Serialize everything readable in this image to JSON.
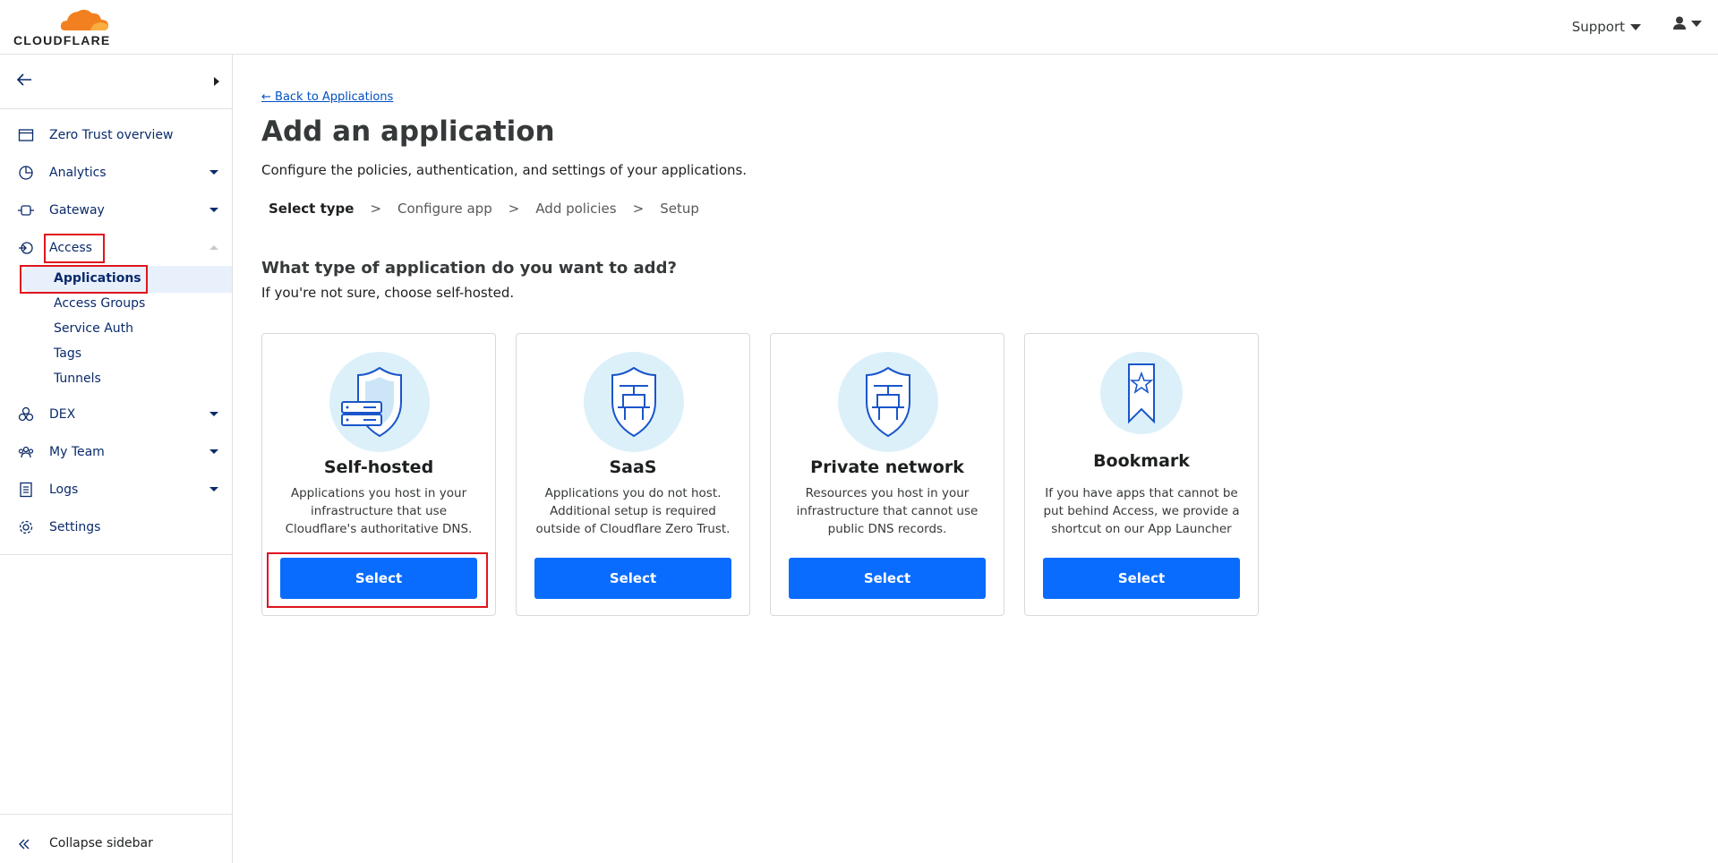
{
  "header": {
    "logo_text": "CLOUDFLARE",
    "support_label": "Support"
  },
  "sidebar": {
    "items": [
      {
        "label": "Zero Trust overview",
        "icon": "browser-window-icon"
      },
      {
        "label": "Analytics",
        "icon": "pie-chart-icon"
      },
      {
        "label": "Gateway",
        "icon": "gateway-icon"
      },
      {
        "label": "Access",
        "icon": "access-icon"
      },
      {
        "label": "DEX",
        "icon": "dex-icon"
      },
      {
        "label": "My Team",
        "icon": "team-icon"
      },
      {
        "label": "Logs",
        "icon": "logs-icon"
      },
      {
        "label": "Settings",
        "icon": "gear-icon"
      }
    ],
    "access_sub": [
      "Applications",
      "Access Groups",
      "Service Auth",
      "Tags",
      "Tunnels"
    ],
    "collapse_label": "Collapse sidebar"
  },
  "main": {
    "back_link": "← Back to Applications",
    "title": "Add an application",
    "description": "Configure the policies, authentication, and settings of your applications.",
    "steps": [
      "Select type",
      "Configure app",
      "Add policies",
      "Setup"
    ],
    "step_separator": ">",
    "question": "What type of application do you want to add?",
    "question_sub": "If you're not sure, choose self-hosted.",
    "cards": [
      {
        "title": "Self-hosted",
        "desc": "Applications you host in your infrastructure that use Cloudflare's authoritative DNS.",
        "button": "Select"
      },
      {
        "title": "SaaS",
        "desc": "Applications you do not host. Additional setup is required outside of Cloudflare Zero Trust.",
        "button": "Select"
      },
      {
        "title": "Private network",
        "desc": "Resources you host in your infrastructure that cannot use public DNS records.",
        "button": "Select"
      },
      {
        "title": "Bookmark",
        "desc": "If you have apps that cannot be put behind Access, we provide a shortcut on our App Launcher",
        "button": "Select"
      }
    ]
  },
  "colors": {
    "accent": "#0a6cff",
    "nav_text": "#0a2a6b",
    "highlight": "#e0141e",
    "icon_bg": "#dcf0fa",
    "logo_orange": "#f38020"
  }
}
